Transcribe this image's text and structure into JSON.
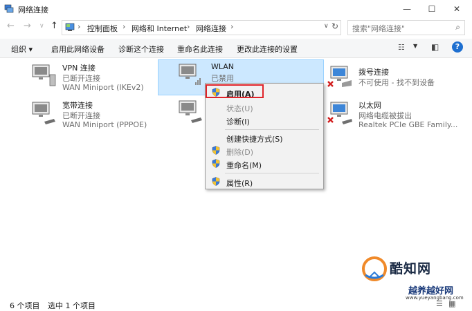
{
  "window": {
    "title": "网络连接",
    "minimize": "—",
    "maximize": "☐",
    "close": "✕"
  },
  "address": {
    "crumbs": [
      "控制面板",
      "网络和 Internet",
      "网络连接"
    ],
    "separator": "›",
    "search_placeholder": "搜索\"网络连接\""
  },
  "toolbar": {
    "organize": "组织 ▾",
    "enable_device": "启用此网络设备",
    "diagnose": "诊断这个连接",
    "rename": "重命名此连接",
    "change_settings": "更改此连接的设置"
  },
  "items": [
    {
      "name": "VPN 连接",
      "status": "已断开连接",
      "device": "WAN Miniport (IKEv2)"
    },
    {
      "name": "宽带连接",
      "status": "已断开连接",
      "device": "WAN Miniport (PPPOE)"
    },
    {
      "name": "WLAN",
      "status": "已禁用",
      "device": ""
    },
    {
      "name": "拨号连接",
      "status": "不可使用 - 找不到设备",
      "device": ""
    },
    {
      "name": "以太网",
      "status": "网络电缆被拔出",
      "device": "Realtek PCIe GBE Family..."
    }
  ],
  "context_menu": {
    "enable": "启用(A)",
    "status": "状态(U)",
    "diagnose": "诊断(I)",
    "create_shortcut": "创建快捷方式(S)",
    "delete": "删除(D)",
    "rename": "重命名(M)",
    "properties": "属性(R)"
  },
  "statusbar": {
    "count": "6 个项目",
    "selected": "选中 1 个项目"
  },
  "watermark": {
    "brand": "酷知网",
    "site": "越养越好网",
    "url": "www.yueyangbang.com"
  },
  "colors": {
    "selection": "#cce8ff",
    "highlight_box": "#e0242a",
    "help": "#1e6fd0"
  }
}
